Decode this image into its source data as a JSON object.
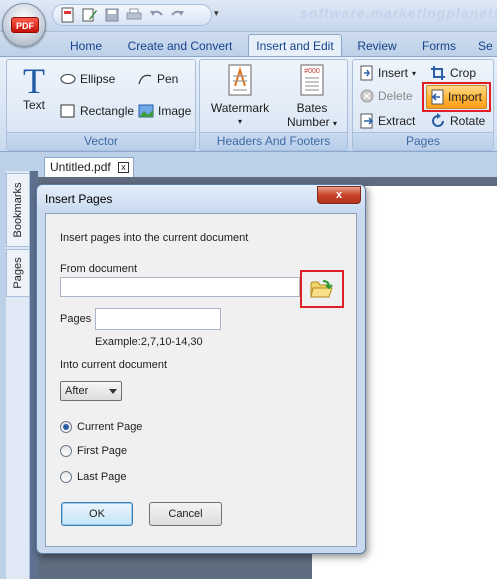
{
  "app": {
    "logo_text": "PDF",
    "watermark": "software.marketingplanets"
  },
  "tabs": [
    {
      "label": "Home"
    },
    {
      "label": "Create and Convert"
    },
    {
      "label": "Insert and Edit"
    },
    {
      "label": "Review"
    },
    {
      "label": "Forms"
    },
    {
      "label": "Se"
    }
  ],
  "ribbon": {
    "vector": {
      "label": "Vector",
      "text_label": "Text",
      "ellipse_label": "Ellipse",
      "pen_label": "Pen",
      "rectangle_label": "Rectangle",
      "image_label": "Image"
    },
    "headers": {
      "label": "Headers And Footers",
      "watermark_label": "Watermark",
      "bates_line1": "Bates",
      "bates_line2": "Number",
      "bates_icon_text": "#000"
    },
    "pages": {
      "label": "Pages",
      "insert_label": "Insert",
      "crop_label": "Crop",
      "delete_label": "Delete",
      "import_label": "Import",
      "extract_label": "Extract",
      "rotate_label": "Rotate"
    }
  },
  "side_tabs": {
    "bookmarks": "Bookmarks",
    "pages": "Pages"
  },
  "document_tab": {
    "name": "Untitled.pdf",
    "close": "x"
  },
  "dialog": {
    "title": "Insert Pages",
    "close": "x",
    "instruction": "Insert pages into the current document",
    "from_document_label": "From document",
    "from_document_value": "",
    "pages_label": "Pages",
    "pages_value": "",
    "example": "Example:2,7,10-14,30",
    "into_label": "Into current document",
    "position_value": "After",
    "radio_options": [
      {
        "label": "Current Page",
        "selected": true
      },
      {
        "label": "First Page",
        "selected": false
      },
      {
        "label": "Last Page",
        "selected": false
      }
    ],
    "ok_label": "OK",
    "cancel_label": "Cancel"
  },
  "colors": {
    "highlight_red": "#e01e26",
    "import_orange": "#ffb83d",
    "ribbon_text": "#15428b"
  }
}
